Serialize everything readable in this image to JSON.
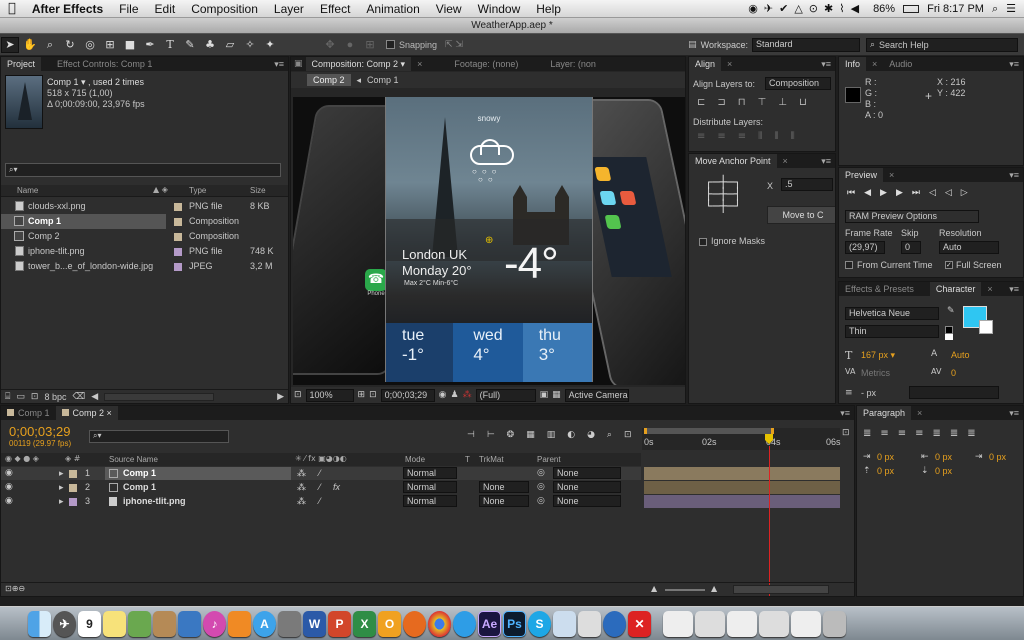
{
  "menubar": {
    "apple": "",
    "app": "After Effects",
    "items": [
      "File",
      "Edit",
      "Composition",
      "Layer",
      "Effect",
      "Animation",
      "View",
      "Window",
      "Help"
    ],
    "battery": "86%",
    "clock": "Fri 8:17 PM"
  },
  "window": {
    "title": "WeatherApp.aep *"
  },
  "toolbar": {
    "snapping": "Snapping",
    "workspace_label": "Workspace:",
    "workspace_value": "Standard",
    "search_placeholder": "Search Help"
  },
  "project": {
    "tabs": [
      "Project",
      "Effect Controls: Comp 1"
    ],
    "comp_name": "Comp 1 ▾ , used 2 times",
    "comp_size": "518 x 715 (1,00)",
    "comp_duration": "Δ 0;00:09:00, 23,976 fps",
    "search_placeholder": "⌕▾",
    "columns": [
      "Name",
      "Type",
      "Size"
    ],
    "items": [
      {
        "name": "clouds-xxl.png",
        "type": "PNG file",
        "size": "8 KB",
        "color": "#c8b89a"
      },
      {
        "name": "Comp 1",
        "type": "Composition",
        "size": "",
        "color": "#c8b89a"
      },
      {
        "name": "Comp 2",
        "type": "Composition",
        "size": "",
        "color": "#c8b89a"
      },
      {
        "name": "iphone-tlit.png",
        "type": "PNG file",
        "size": "748 K",
        "color": "#b49ac8"
      },
      {
        "name": "tower_b...e_of_london-wide.jpg",
        "type": "JPEG",
        "size": "3,2 M",
        "color": "#b49ac8"
      }
    ],
    "bpc": "8 bpc"
  },
  "composition": {
    "tab": "Composition: Comp 2 ▾",
    "footage_tab": "Footage: (none)",
    "layer_tab": "Layer: (non",
    "crumbs": [
      "Comp 2",
      "Comp 1"
    ],
    "zoom": "100%",
    "timecode": "0;00;03;29",
    "resolution": "(Full)",
    "camera": "Active Camera"
  },
  "weather": {
    "condition": "snowy",
    "city": "London UK",
    "day_temp": "Monday 20°",
    "minmax": "Max 2°C  Min-6°C",
    "temp": "-4°",
    "forecast": [
      {
        "day": "tue",
        "temp": "-1°"
      },
      {
        "day": "wed",
        "temp": "4°"
      },
      {
        "day": "thu",
        "temp": "3°"
      }
    ]
  },
  "iphone": {
    "phone_label": "Phone"
  },
  "align": {
    "tab": "Align",
    "align_to_label": "Align Layers to:",
    "align_to_value": "Composition",
    "distribute_label": "Distribute Layers:"
  },
  "anchor": {
    "tab": "Move Anchor Point",
    "x_label": "X",
    "x_value": ".5",
    "move_button": "Move to C",
    "ignore_masks": "Ignore Masks"
  },
  "info": {
    "tabs": [
      "Info",
      "Audio"
    ],
    "r": "R :",
    "g": "G :",
    "b": "B :",
    "a": "A : 0",
    "x": "X : 216",
    "y": "Y : 422"
  },
  "preview": {
    "tab": "Preview",
    "ram": "RAM Preview Options",
    "fr_label": "Frame Rate",
    "skip_label": "Skip",
    "res_label": "Resolution",
    "fr_value": "(29,97)",
    "skip_value": "0",
    "res_value": "Auto",
    "from_current": "From Current Time",
    "full_screen": "Full Screen"
  },
  "character": {
    "tabs": [
      "Effects & Presets",
      "Character"
    ],
    "font": "Helvetica Neue",
    "style": "Thin",
    "size": "167 px ▾",
    "leading": "Auto",
    "kerning": "Metrics",
    "tracking": "0",
    "stroke": "- px",
    "fill_color": "#2fc6f2"
  },
  "paragraph": {
    "tab": "Paragraph",
    "values": [
      "0 px",
      "0 px",
      "0 px",
      "0 px",
      "0 px"
    ]
  },
  "timeline": {
    "tabs": [
      "Comp 1",
      "Comp 2"
    ],
    "timecode": "0;00;03;29",
    "frames": "00119 (29.97 fps)",
    "columns": {
      "source": "Source Name",
      "mode": "Mode",
      "t": "T",
      "trkmat": "TrkMat",
      "parent": "Parent"
    },
    "ruler": [
      "0s",
      "02s",
      "04s",
      "06s"
    ],
    "layers": [
      {
        "num": "1",
        "name": "Comp 1",
        "mode": "Normal",
        "trkmat": "",
        "parent": "None",
        "color": "#c8b89a"
      },
      {
        "num": "2",
        "name": "Comp 1",
        "mode": "Normal",
        "trkmat": "None",
        "parent": "None",
        "color": "#c8b89a"
      },
      {
        "num": "3",
        "name": "iphone-tlit.png",
        "mode": "Normal",
        "trkmat": "None",
        "parent": "None",
        "color": "#b49ac8"
      }
    ]
  },
  "dock": {
    "calendar_day": "9"
  }
}
